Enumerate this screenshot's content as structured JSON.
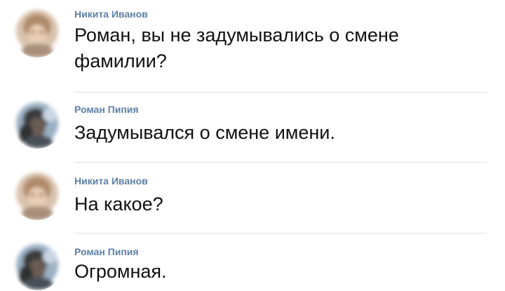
{
  "messages": [
    {
      "author": "Никита Иванов",
      "text": "Роман, вы не задумывались о смене фамилии?",
      "avatar": "blurred-avatar-light",
      "author_color": "#5b7fa6"
    },
    {
      "author": "Роман Пипия",
      "text": "Задумывался о смене имени.",
      "avatar": "blurred-avatar-dark",
      "author_color": "#5b7fa6"
    },
    {
      "author": "Никита Иванов",
      "text": "На какое?",
      "avatar": "blurred-avatar-light",
      "author_color": "#5b7fa6"
    },
    {
      "author": "Роман Пипия",
      "text": "Огромная.",
      "avatar": "blurred-avatar-dark",
      "author_color": "#5b7fa6"
    }
  ]
}
